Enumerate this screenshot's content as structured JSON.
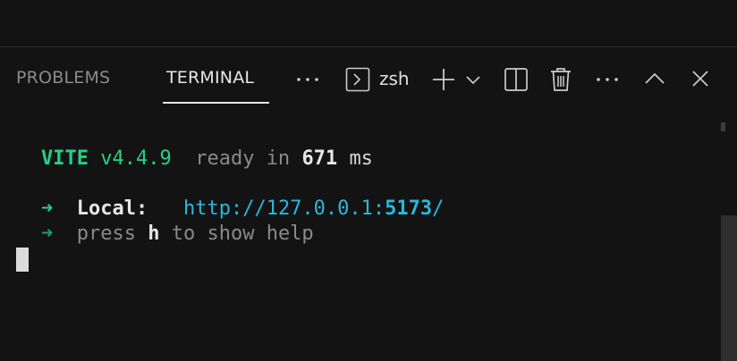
{
  "panel": {
    "tabs": [
      {
        "label": "PROBLEMS",
        "active": false
      },
      {
        "label": "TERMINAL",
        "active": true
      }
    ],
    "shell_name": "zsh",
    "icons": {
      "more_tabs": "ellipsis-icon",
      "shell": "terminal-icon",
      "new_terminal": "plus-icon",
      "dropdown": "chevron-down-icon",
      "split": "split-terminal-icon",
      "kill": "trash-icon",
      "more_actions": "ellipsis-icon",
      "maximize": "chevron-up-icon",
      "close": "close-icon"
    }
  },
  "terminal": {
    "vite_name": "VITE",
    "vite_version": "v4.4.9",
    "ready_prefix": "ready in",
    "ready_ms": "671",
    "ready_unit": "ms",
    "arrow": "➜",
    "local_label": "Local:",
    "local_url_base": "http://127.0.0.1:",
    "local_url_port": "5173",
    "local_url_suffix": "/",
    "help_prefix": "press",
    "help_key": "h",
    "help_suffix": "to show help"
  },
  "colors": {
    "background": "#131313",
    "green": "#23d18b",
    "cyan": "#29b8db",
    "dim": "#8a8a8a"
  }
}
